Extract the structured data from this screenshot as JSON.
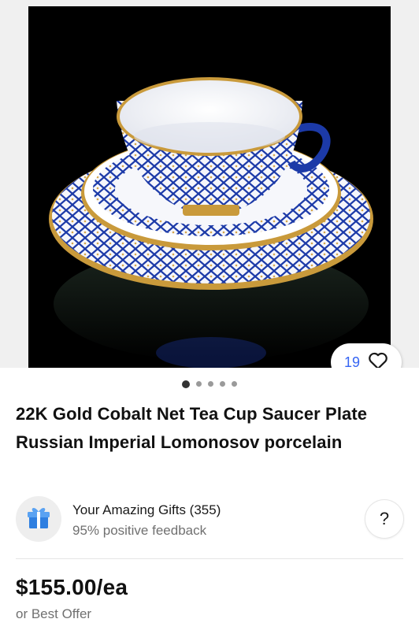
{
  "listing": {
    "image_alt": "Cobalt net tea cup with saucer and plate",
    "watch_count": "19",
    "gallery": {
      "total_images": 5,
      "active_index": 0
    },
    "title": "22K Gold Cobalt Net Tea Cup Saucer Plate Russian Imperial Lomonosov porcelain",
    "price": "$155.00/ea",
    "offer_text": "or Best Offer"
  },
  "seller": {
    "name": "Your Amazing Gifts (355)",
    "feedback": "95% positive feedback",
    "help_label": "?"
  },
  "colors": {
    "accent_blue": "#3665f3",
    "cobalt": "#1c3aa8",
    "gold": "#c99a3b",
    "muted_text": "#707070"
  },
  "icons": [
    "heart-icon",
    "gift-icon",
    "question-icon"
  ]
}
